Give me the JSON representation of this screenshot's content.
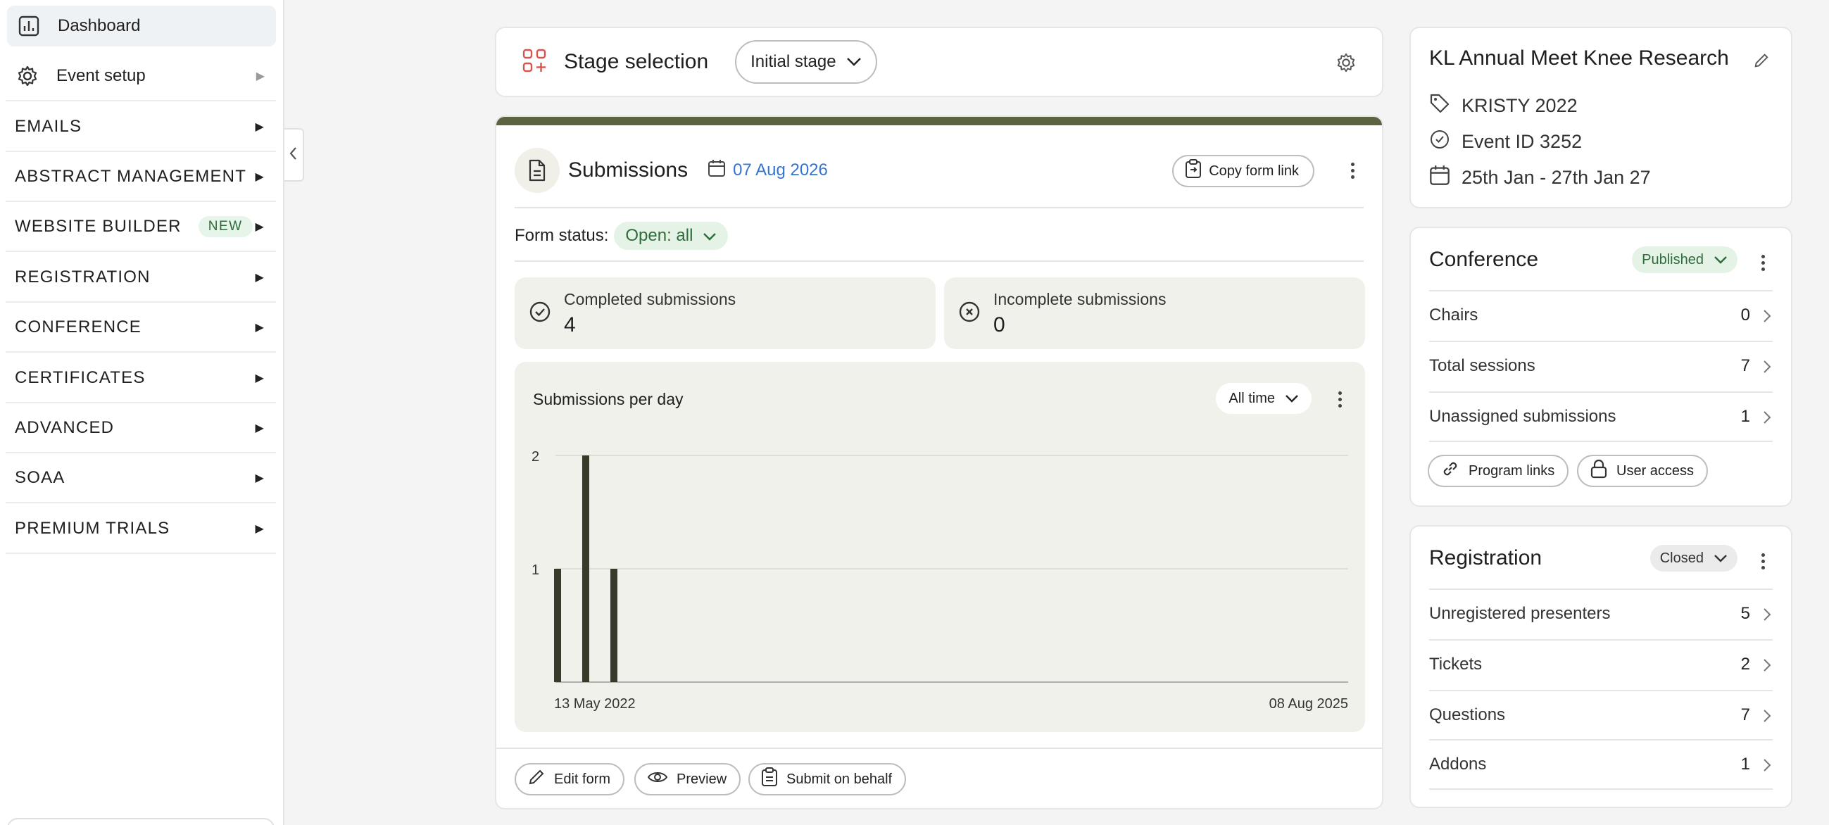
{
  "sidebar": {
    "items": [
      {
        "label": "Dashboard",
        "icon": "bar-chart-icon"
      },
      {
        "label": "Event setup",
        "icon": "gear-icon"
      },
      {
        "label": "EMAILS"
      },
      {
        "label": "ABSTRACT MANAGEMENT"
      },
      {
        "label": "WEBSITE BUILDER",
        "badge": "NEW"
      },
      {
        "label": "REGISTRATION"
      },
      {
        "label": "CONFERENCE"
      },
      {
        "label": "CERTIFICATES"
      },
      {
        "label": "ADVANCED"
      },
      {
        "label": "SOAA"
      },
      {
        "label": "PREMIUM TRIALS"
      }
    ]
  },
  "stage": {
    "title": "Stage selection",
    "selected": "Initial stage"
  },
  "submissions": {
    "title": "Submissions",
    "date": "07 Aug 2026",
    "copy_label": "Copy form link",
    "form_status_label": "Form status:",
    "form_status_value": "Open: all",
    "completed_label": "Completed submissions",
    "completed_value": "4",
    "incomplete_label": "Incomplete submissions",
    "incomplete_value": "0",
    "footer": {
      "edit": "Edit form",
      "preview": "Preview",
      "submit_behalf": "Submit on behalf"
    }
  },
  "chart_data": {
    "type": "bar",
    "title": "Submissions per day",
    "range_selector": "All time",
    "x_start_label": "13 May 2022",
    "x_end_label": "08 Aug 2025",
    "values": [
      1,
      2,
      1
    ],
    "yticks": [
      "1",
      "2"
    ],
    "ylim": [
      0,
      2
    ],
    "bar_color": "#383a2a",
    "grid": true
  },
  "event": {
    "title": "KL Annual Meet Knee Research",
    "tag": "KRISTY 2022",
    "event_id": "Event ID 3252",
    "dates": "25th Jan - 27th Jan 27"
  },
  "conference": {
    "title": "Conference",
    "status": "Published",
    "rows": [
      {
        "label": "Chairs",
        "value": "0"
      },
      {
        "label": "Total sessions",
        "value": "7"
      },
      {
        "label": "Unassigned submissions",
        "value": "1"
      }
    ],
    "program_links": "Program links",
    "user_access": "User access"
  },
  "registration": {
    "title": "Registration",
    "status": "Closed",
    "rows": [
      {
        "label": "Unregistered presenters",
        "value": "5"
      },
      {
        "label": "Tickets",
        "value": "2"
      },
      {
        "label": "Questions",
        "value": "7"
      },
      {
        "label": "Addons",
        "value": "1"
      }
    ]
  },
  "colors": {
    "accent_bar": "#5c6340",
    "link_blue": "#3574d4",
    "published_bg": "#e4f3e6",
    "closed_bg": "#ebebeb",
    "stage_icon": "#d9534f"
  }
}
